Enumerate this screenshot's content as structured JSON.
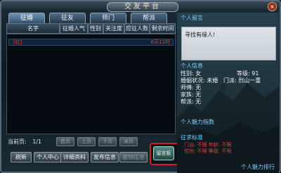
{
  "window": {
    "title": "交友平台",
    "close_glyph": "×"
  },
  "tabs": [
    "征婚",
    "征友",
    "师门",
    "帮派"
  ],
  "columns": [
    "名字",
    "征婚人气",
    "性别",
    "关注度",
    "应征人数",
    "剩余时间"
  ],
  "list": {
    "row": {
      "name": "[红]",
      "time": "6天11时"
    }
  },
  "pager": {
    "label": "当前页:",
    "value": "1/1",
    "buttons": [
      "首页",
      "上页",
      "下页",
      "末页"
    ]
  },
  "buttons": {
    "refresh": "刷新",
    "personal_center": "个人中心",
    "details": "详细资料",
    "publish": "发布信息",
    "withdraw": "撤销信息",
    "message": "留言板"
  },
  "right": {
    "message_title": "个人留言",
    "message_text": "寻找有缘人!",
    "info_title": "个人信息",
    "gender_label": "性别: 女",
    "level_label": "等级: 91",
    "marriage_label": "婚姻状况: 未婚",
    "sect_label": "门派: 烈山一重",
    "master_label": "师傅: 无",
    "clan_label": "家族: 无",
    "guild_label": "帮派: 无",
    "charm_title": "个人魅力指数",
    "requirements_title": "征求标准",
    "req_line1": "门派: 不限  年龄: 不限",
    "req_line2": "性别: 不限  等级: 不限",
    "ranking_link": "个人魅力排行"
  }
}
